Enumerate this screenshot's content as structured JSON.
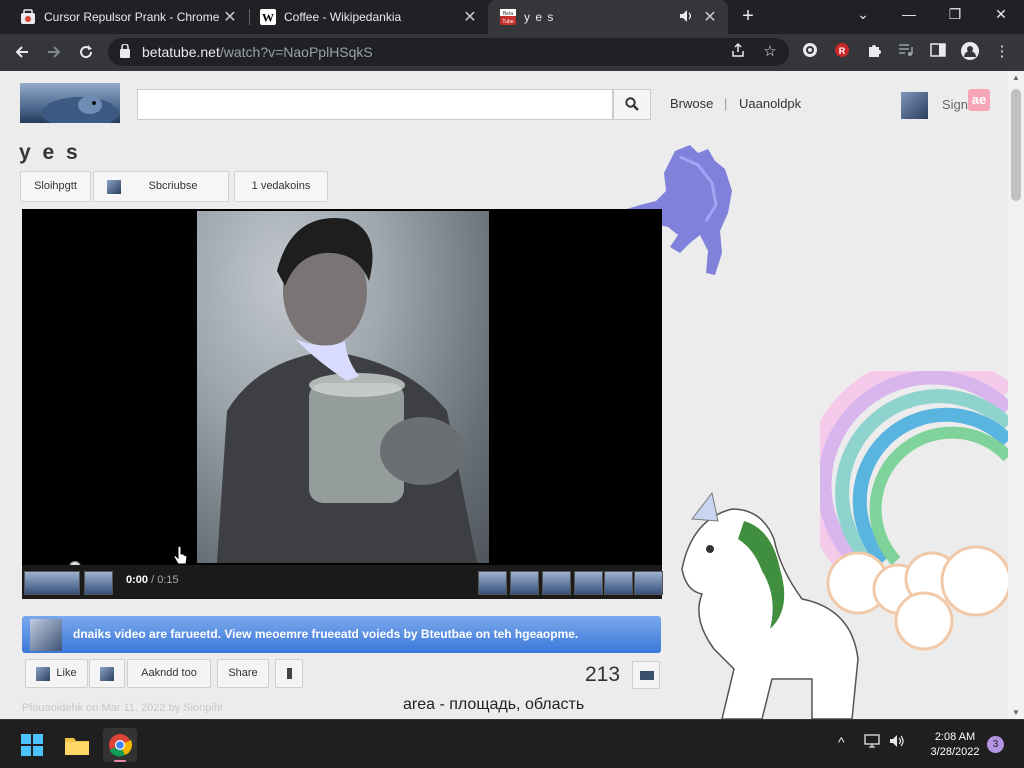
{
  "tabs": [
    {
      "title": "Cursor Repulsor Prank - Chrome",
      "close": "✕"
    },
    {
      "title": "Coffee - Wikipedankia",
      "close": "✕"
    },
    {
      "title": "y e s",
      "close": "✕"
    }
  ],
  "window": {
    "minimize": "—",
    "restore": "❐",
    "close": "✕",
    "tab_search": "⌄"
  },
  "toolbar": {
    "url_host": "betatube.net",
    "url_path": "/watch?v=NaoPplHSqkS"
  },
  "header": {
    "search_placeholder": "",
    "browse": "Brwose",
    "upload": "Uaanoldpk",
    "signin": "Sign",
    "badge": "ae"
  },
  "video": {
    "title": "y e s",
    "subscribe_left": "Sloihpgtt",
    "subscribe": "Sbcriubse",
    "video_count": "1 vedakoins",
    "time_current": "0:00",
    "time_total": " / 0:15",
    "progress_fraction": 0.07
  },
  "banner": {
    "text": "dnaiks video are farueetd. View meoemre frueeatd voieds by Bteutbae on teh hgeaopme."
  },
  "actions": {
    "like": "Like",
    "add_to": "Aakndd too",
    "share": "Share",
    "views": "213"
  },
  "uploaded_line": "Pfouaoidehk on Mar 11, 2022 by Sionpihl",
  "caption": "area - площадь, область",
  "taskbar": {
    "time": "2:08 AM",
    "date": "3/28/2022",
    "notifications": "3"
  },
  "colors": {
    "banner": "#4a86e0",
    "chrome_dark": "#202124",
    "toolbar": "#35363a"
  }
}
